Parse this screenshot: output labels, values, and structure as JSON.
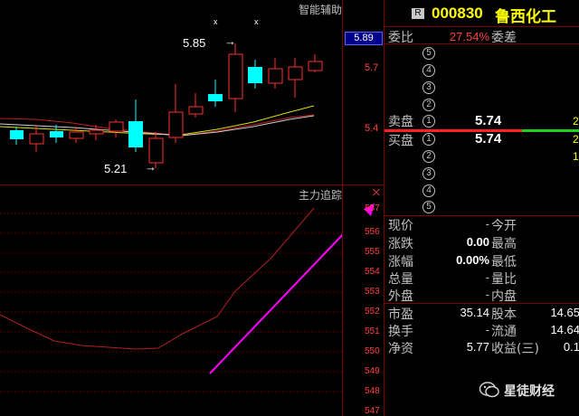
{
  "stock": {
    "badge": "R",
    "code": "000830",
    "name": "鲁西化工"
  },
  "indicators": {
    "main_panel": "智能辅助",
    "sub_panel": "主力追踪",
    "close_x": "×"
  },
  "price_axis": {
    "current_tag": "5.89",
    "ticks": [
      "5.7",
      "5.4"
    ]
  },
  "candle_annotations": {
    "high": "5.85",
    "low": "5.21",
    "marker_x1": "x",
    "marker_x2": "x"
  },
  "sub_axis": {
    "ticks": [
      "557",
      "556",
      "555",
      "554",
      "553",
      "552",
      "551",
      "550",
      "549",
      "548",
      "547"
    ]
  },
  "order_book": {
    "webi_label": "委比",
    "webi_value": "27.54%",
    "weicha_label": "委差",
    "sell_levels": [
      "5",
      "4",
      "3",
      "2"
    ],
    "sell_label": "卖盘",
    "sell_level1": "1",
    "sell_price": "5.74",
    "sell_vol": "2",
    "buy_label": "买盘",
    "buy_level1": "1",
    "buy_price": "5.74",
    "buy_vol": "2",
    "buy_levels": [
      "2",
      "3",
      "4",
      "5"
    ],
    "buy_level2_vol": "1"
  },
  "quote_table": {
    "rows": [
      {
        "l1": "现价",
        "v1": "-",
        "l2": "今开",
        "v2": ""
      },
      {
        "l1": "涨跌",
        "v1": "0.00",
        "l2": "最高",
        "v2": ""
      },
      {
        "l1": "涨幅",
        "v1": "0.00%",
        "l2": "最低",
        "v2": ""
      },
      {
        "l1": "总量",
        "v1": "-",
        "l2": "量比",
        "v2": ""
      },
      {
        "l1": "外盘",
        "v1": "-",
        "l2": "内盘",
        "v2": ""
      },
      {
        "l1": "市盈",
        "v1": "35.14",
        "l2": "股本",
        "v2": "14.65"
      },
      {
        "l1": "换手",
        "v1": "-",
        "l2": "流通",
        "v2": "14.64"
      },
      {
        "l1": "净资",
        "v1": "5.77",
        "l2": "收益(三)",
        "v2": "0.1"
      }
    ]
  },
  "watermark": {
    "text": "星徒财经"
  },
  "colors": {
    "up": "#ff3030",
    "down": "#00ffff",
    "ma_yellow": "#e0e000",
    "ma_red": "#cc2020",
    "magenta": "#ff00ff",
    "frame": "#7a0000",
    "sell_bar": "#ff2020",
    "buy_bar": "#20d020"
  }
}
